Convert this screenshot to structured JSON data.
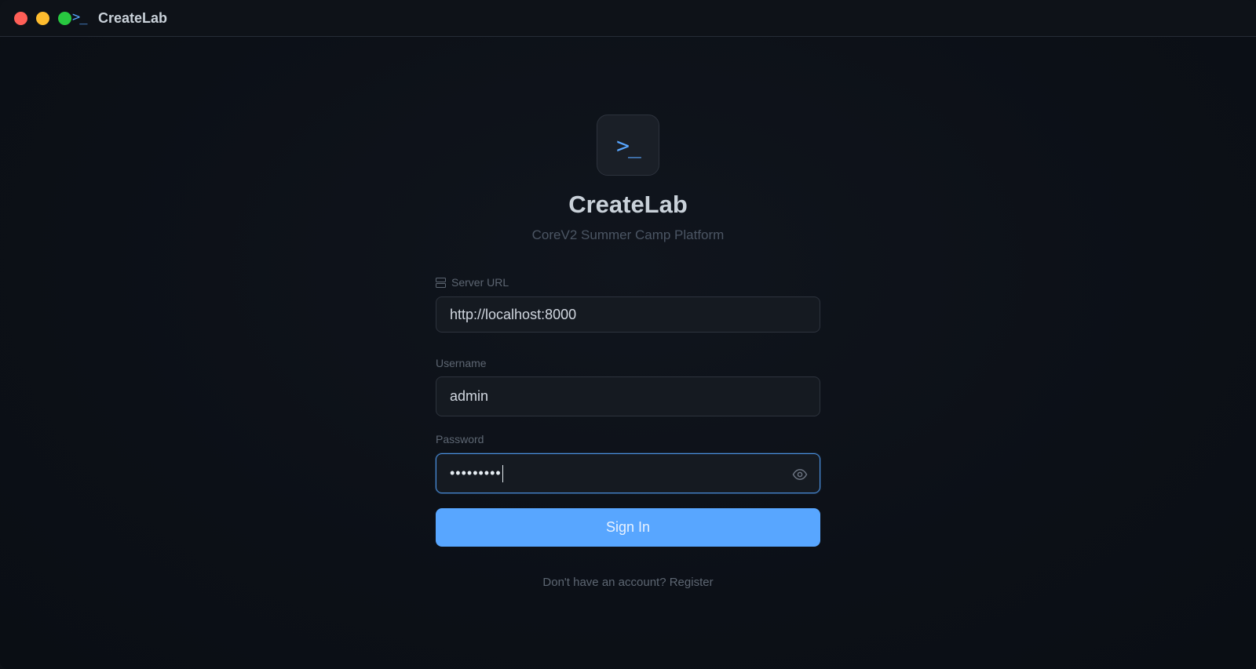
{
  "window": {
    "title": "CreateLab",
    "title_icon": "terminal-prompt-icon",
    "title_glyph": ">_"
  },
  "brand": {
    "logo_icon": "terminal-prompt-icon",
    "logo_glyph": ">_",
    "name": "CreateLab",
    "subtitle": "CoreV2 Summer Camp Platform",
    "accent_color": "#58a6ff"
  },
  "form": {
    "server_url": {
      "label": "Server URL",
      "icon": "server-icon",
      "value": "http://localhost:8000"
    },
    "username": {
      "label": "Username",
      "value": "admin"
    },
    "password": {
      "label": "Password",
      "masked_value": "•••••••••",
      "toggle_icon": "eye-icon"
    },
    "submit_label": "Sign In",
    "register_text": "Don't have an account? Register"
  }
}
